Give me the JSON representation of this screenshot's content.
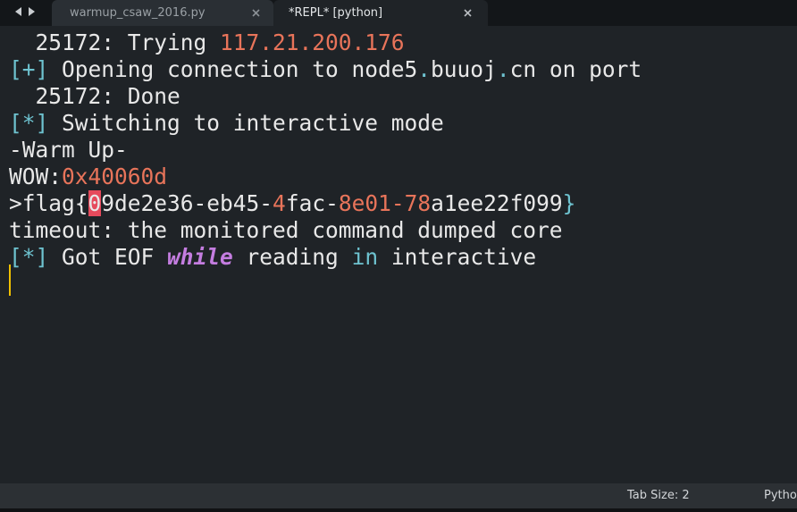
{
  "tabs": [
    {
      "label": "warmup_csaw_2016.py",
      "active": false
    },
    {
      "label": "*REPL* [python]",
      "active": true
    }
  ],
  "icons": {
    "back": "left-arrow-icon",
    "forward": "right-arrow-icon",
    "close": "close-icon"
  },
  "colors": {
    "background": "#1f2327",
    "text": "#e8e8e8",
    "orange": "#e8745a",
    "cyan": "#6ec3d0",
    "keyword": "#c47de0",
    "highlight": "#e64a5c",
    "cursor": "#f0c000"
  },
  "terminal": {
    "line1": {
      "pid": "  25172: Trying ",
      "ip": "117.21.200.176"
    },
    "line2": {
      "marker": "[+]",
      "text": " Opening connection to node5",
      "dot": ".",
      "host_a": "buuoj",
      "dot2": ".",
      "host_b": "cn on port"
    },
    "line3": {
      "text": "  25172: Done"
    },
    "line4": {
      "marker": "[*]",
      "text": " Switching to interactive mode"
    },
    "line5": {
      "text": "-Warm Up-"
    },
    "line6": {
      "label": "WOW:",
      "addr": "0x40060d"
    },
    "line7": {
      "prefix": ">flag{",
      "selected_char": "0",
      "p1": "9de2e36-eb45-",
      "p2": "4",
      "p3": "fac-",
      "p4": "8e01-78",
      "p5": "a1ee22f099",
      "suffix": "}"
    },
    "line8": {
      "text": "timeout: the monitored command dumped core"
    },
    "line9": {
      "marker": "[*]",
      "t1": " Got EOF ",
      "kw1": "while",
      "t2": " reading ",
      "kw2": "in",
      "t3": " interactive"
    }
  },
  "statusbar": {
    "tab_size": "Tab Size: 2",
    "syntax": "Python"
  }
}
